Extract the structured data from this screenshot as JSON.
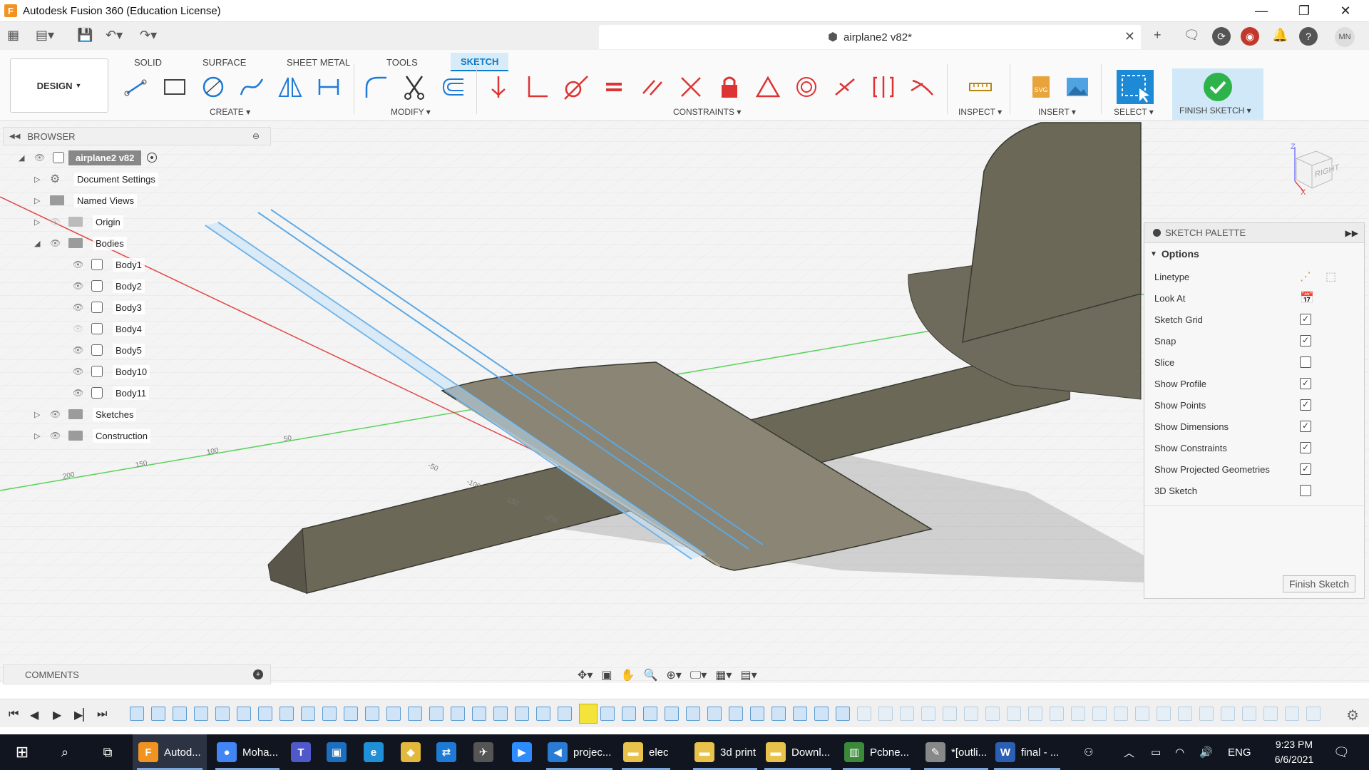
{
  "window": {
    "title": "Autodesk Fusion 360 (Education License)",
    "app_icon_letter": "F",
    "controls": [
      "—",
      "❐",
      "✕"
    ]
  },
  "appbar": {
    "doc_tab": "airplane2 v82*",
    "user_initials": "MN"
  },
  "ribbon": {
    "workspace": "DESIGN",
    "tabs": [
      "SOLID",
      "SURFACE",
      "SHEET METAL",
      "TOOLS",
      "SKETCH"
    ],
    "active_tab": "SKETCH",
    "groups": {
      "create": "CREATE",
      "modify": "MODIFY",
      "constraints": "CONSTRAINTS",
      "inspect": "INSPECT",
      "insert": "INSERT",
      "select": "SELECT",
      "finish": "FINISH SKETCH"
    },
    "accent_color": "#0a7ac9",
    "finish_color": "#2db34a"
  },
  "browser": {
    "title": "BROWSER",
    "root": "airplane2 v82",
    "items": [
      {
        "label": "Document Settings"
      },
      {
        "label": "Named Views"
      },
      {
        "label": "Origin"
      },
      {
        "label": "Bodies"
      },
      {
        "label": "Body1"
      },
      {
        "label": "Body2"
      },
      {
        "label": "Body3"
      },
      {
        "label": "Body4"
      },
      {
        "label": "Body5"
      },
      {
        "label": "Body10"
      },
      {
        "label": "Body11"
      },
      {
        "label": "Sketches"
      },
      {
        "label": "Construction"
      }
    ]
  },
  "comments": {
    "title": "COMMENTS"
  },
  "viewcube": {
    "face": "RIGHT",
    "axis_z": "Z",
    "axis_x": "X"
  },
  "axis_ticks": [
    "200",
    "150",
    "100",
    "50",
    "-50",
    "-100",
    "-150",
    "-200"
  ],
  "palette": {
    "title": "SKETCH PALETTE",
    "section": "Options",
    "options": [
      {
        "label": "Linetype",
        "kind": "icons"
      },
      {
        "label": "Look At",
        "kind": "icon"
      },
      {
        "label": "Sketch Grid",
        "checked": "✓"
      },
      {
        "label": "Snap",
        "checked": "✓"
      },
      {
        "label": "Slice",
        "checked": ""
      },
      {
        "label": "Show Profile",
        "checked": "✓"
      },
      {
        "label": "Show Points",
        "checked": "✓"
      },
      {
        "label": "Show Dimensions",
        "checked": "✓"
      },
      {
        "label": "Show Constraints",
        "checked": "✓"
      },
      {
        "label": "Show Projected Geometries",
        "checked": "✓"
      },
      {
        "label": "3D Sketch",
        "checked": ""
      }
    ],
    "finish_button": "Finish Sketch"
  },
  "taskbar": {
    "items": [
      {
        "label": "Autod...",
        "icon": "F",
        "color": "#f29321"
      },
      {
        "label": "Moha...",
        "icon": "●",
        "color": "#4285f4"
      },
      {
        "label": "",
        "icon": "T",
        "color": "#5059c9"
      },
      {
        "label": "",
        "icon": "▣",
        "color": "#1c6fbf"
      },
      {
        "label": "",
        "icon": "e",
        "color": "#1f8fd8"
      },
      {
        "label": "",
        "icon": "◆",
        "color": "#e2b93b"
      },
      {
        "label": "",
        "icon": "⇄",
        "color": "#1f7ad6"
      },
      {
        "label": "",
        "icon": "✈",
        "color": "#555"
      },
      {
        "label": "",
        "icon": "▶",
        "color": "#2d8cff"
      },
      {
        "label": "projec...",
        "icon": "◀",
        "color": "#2a7bd4"
      },
      {
        "label": "elec",
        "icon": "▬",
        "color": "#e8c24a"
      },
      {
        "label": "3d print",
        "icon": "▬",
        "color": "#e8c24a"
      },
      {
        "label": "Downl...",
        "icon": "▬",
        "color": "#e8c24a"
      },
      {
        "label": "Pcbne...",
        "icon": "▥",
        "color": "#3a8a3a"
      },
      {
        "label": "*[outli...",
        "icon": "✎",
        "color": "#888"
      },
      {
        "label": "final - ...",
        "icon": "W",
        "color": "#2b5fb4"
      }
    ],
    "lang": "ENG",
    "time": "9:23 PM",
    "date": "6/6/2021"
  }
}
